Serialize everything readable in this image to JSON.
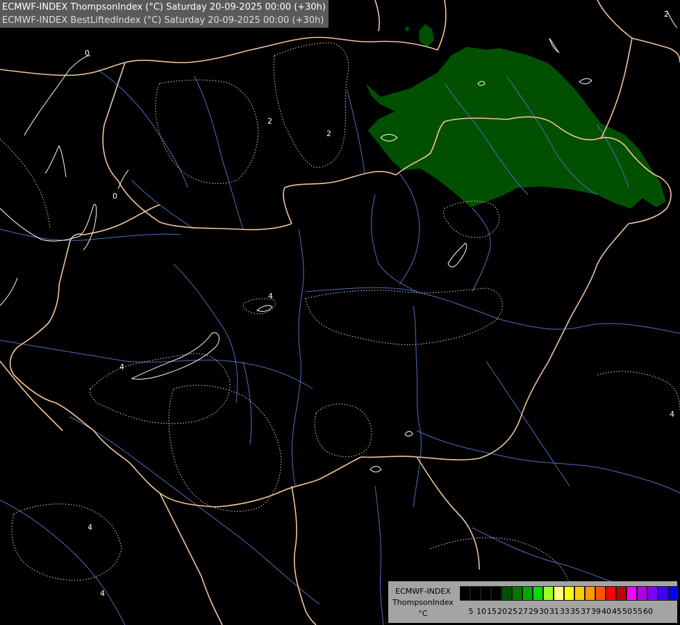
{
  "header": {
    "title_line1": "ECMWF-INDEX ThompsonIndex (°C) Saturday 20-09-2025 00:00 (+30h)",
    "title_line2": "ECMWF-INDEX BestLiftedIndex (°C) Saturday 20-09-2025 00:00 (+30h)"
  },
  "map": {
    "contour_labels": [
      "0",
      "0",
      "2",
      "2",
      "4",
      "4",
      "4",
      "4",
      "4",
      "2"
    ],
    "colors": {
      "background": "#000000",
      "borders": "#f5c99a",
      "rivers": "#5577cc",
      "contours": "#ffffff",
      "shaded_area": "#005000"
    }
  },
  "legend": {
    "name_line1": "ECMWF-INDEX",
    "name_line2": "ThompsonIndex",
    "unit": "°C",
    "ticks": [
      "5",
      "10",
      "15",
      "20",
      "25",
      "27",
      "29",
      "30",
      "31",
      "33",
      "35",
      "37",
      "39",
      "40",
      "45",
      "50",
      "55",
      "60"
    ],
    "colors": [
      "#000000",
      "#000000",
      "#000000",
      "#000000",
      "#005000",
      "#007800",
      "#00a800",
      "#00dc00",
      "#a0ff20",
      "#ffff80",
      "#ffff00",
      "#ffcc00",
      "#ff9900",
      "#ff5500",
      "#ff0000",
      "#c00000",
      "#ff00ff",
      "#b000e0",
      "#8000ff",
      "#4000ff",
      "#0000ff"
    ]
  }
}
